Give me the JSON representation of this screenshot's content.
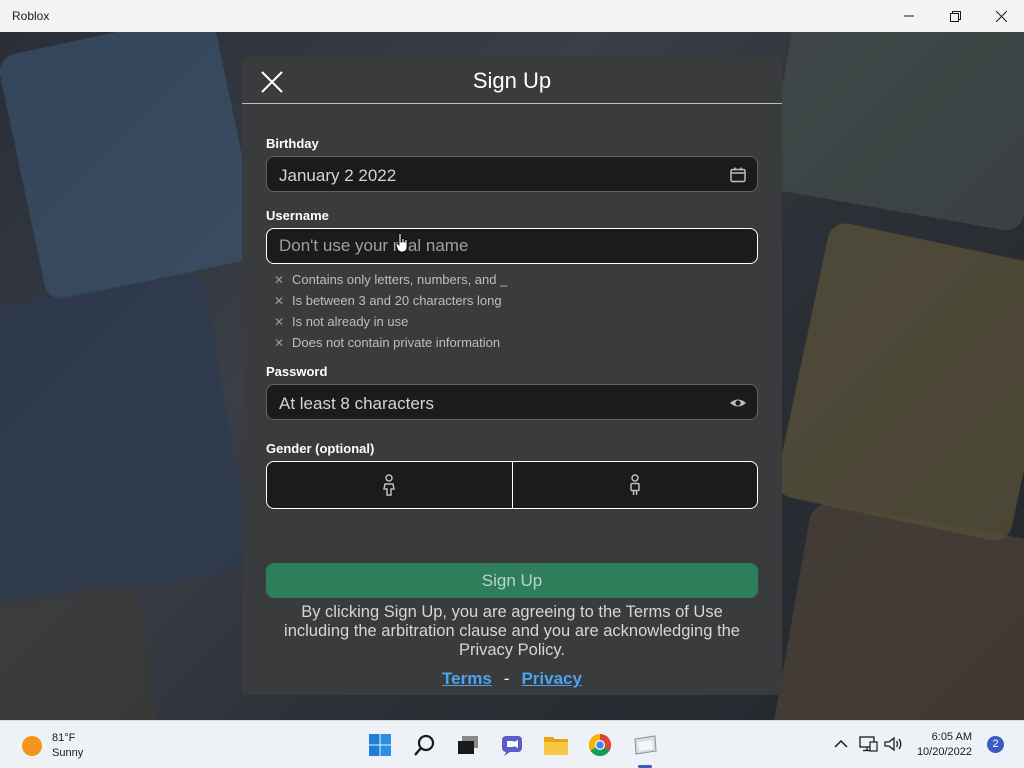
{
  "window": {
    "title": "Roblox"
  },
  "modal": {
    "title": "Sign Up",
    "birthday": {
      "label": "Birthday",
      "value": "January 2 2022"
    },
    "username": {
      "label": "Username",
      "placeholder": "Don't use your real name",
      "rules": [
        "Contains only letters, numbers, and _",
        "Is between 3 and 20 characters long",
        "Is not already in use",
        "Does not contain private information"
      ]
    },
    "password": {
      "label": "Password",
      "placeholder": "At least 8 characters"
    },
    "gender": {
      "label": "Gender (optional)"
    },
    "signup_button": "Sign Up",
    "terms_text": "By clicking Sign Up, you are agreeing to the Terms of Use including the arbitration clause and you are acknowledging the Privacy Policy.",
    "terms_link": "Terms",
    "separator": "-",
    "privacy_link": "Privacy"
  },
  "taskbar": {
    "weather_temp": "81°F",
    "weather_cond": "Sunny",
    "time": "6:05 AM",
    "date": "10/20/2022",
    "notification_count": "2"
  },
  "colors": {
    "modal_bg": "#393b3d",
    "field_bg": "#191b1d",
    "signup_green": "#2e7d5b",
    "link_blue": "#4ea3f1"
  }
}
